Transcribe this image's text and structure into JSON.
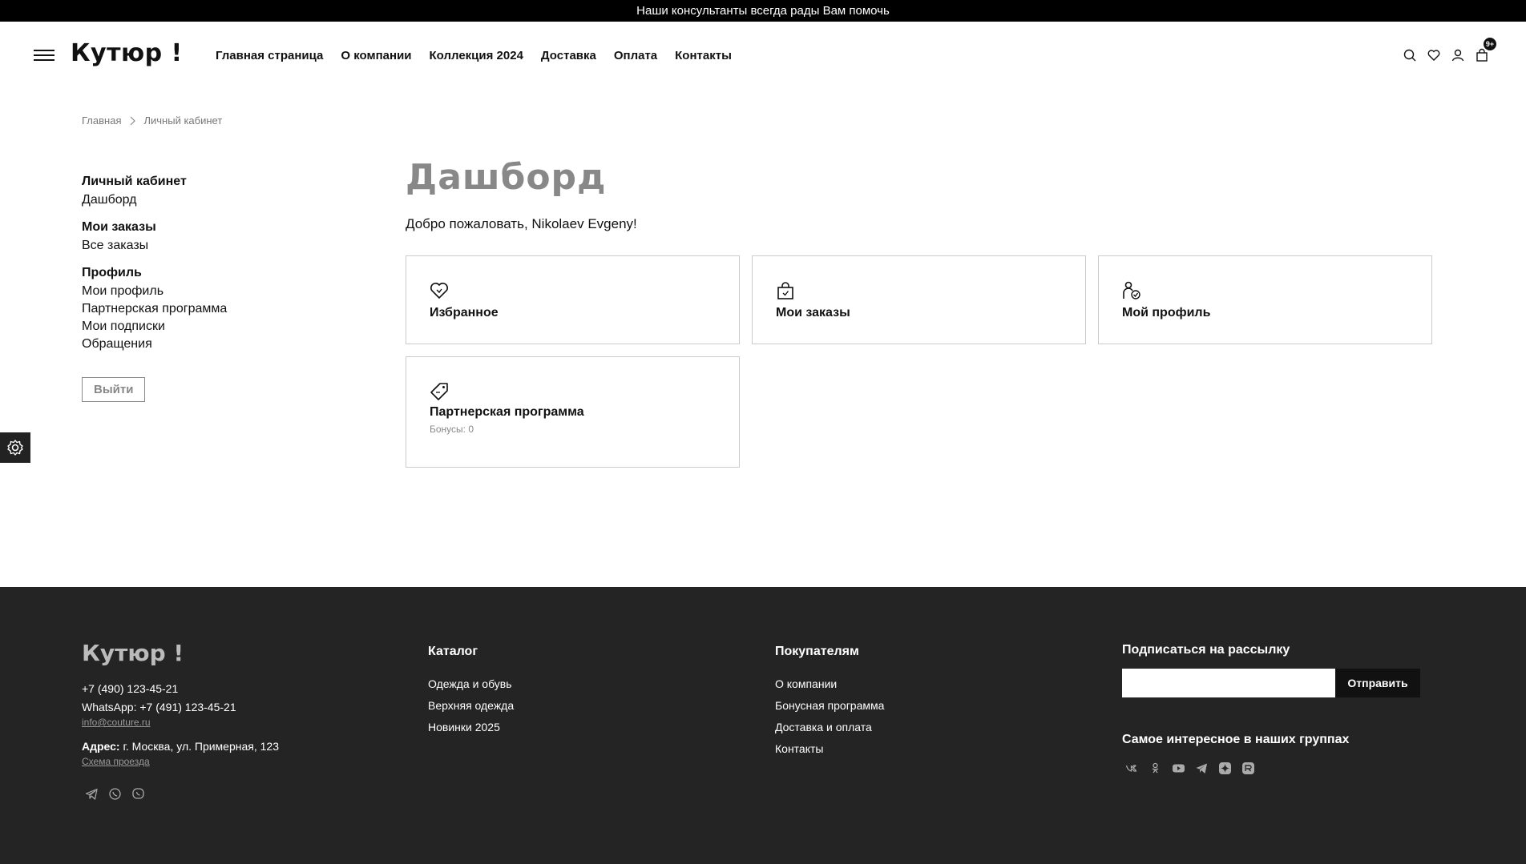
{
  "topbar": {
    "text": "Наши консультанты всегда рады Вам помочь"
  },
  "header": {
    "logo": "Кутюр !",
    "nav": [
      "Главная страница",
      "О компании",
      "Коллекция 2024",
      "Доставка",
      "Оплата",
      "Контакты"
    ],
    "cart_badge": "9+",
    "icons": [
      "search-icon",
      "heart-icon",
      "user-icon",
      "cart-icon"
    ]
  },
  "breadcrumb": {
    "home": "Главная",
    "current": "Личный кабинет"
  },
  "sidebar": {
    "groups": [
      {
        "title": "Личный кабинет",
        "links": [
          "Дашборд"
        ]
      },
      {
        "title": "Мои заказы",
        "links": [
          "Все заказы"
        ]
      },
      {
        "title": "Профиль",
        "links": [
          "Мои профиль",
          "Партнерская программа",
          "Мои подписки",
          "Обращения"
        ]
      }
    ],
    "logout": "Выйти"
  },
  "main": {
    "title": "Дашборд",
    "welcome": "Добро пожаловать, Nikolaev Evgeny!",
    "cards": [
      {
        "title": "Избранное",
        "icon": "heart-icon"
      },
      {
        "title": "Мои заказы",
        "icon": "shopping-bag-icon"
      },
      {
        "title": "Мой профиль",
        "icon": "user-check-icon"
      },
      {
        "title": "Партнерская программа",
        "subtitle": "Бонусы: 0",
        "icon": "price-tag-icon"
      }
    ]
  },
  "footer": {
    "logo": "Кутюр !",
    "phone": "+7 (490) 123-45-21",
    "whatsapp": "WhatsApp: +7 (491) 123-45-21",
    "email": "info@couture.ru",
    "address_label": "Адрес:",
    "address": " г. Москва, ул. Примерная, 123",
    "map_link": "Схема проезда",
    "catalog": {
      "title": "Каталог",
      "links": [
        "Одежда и обувь",
        "Верхняя одежда",
        "Новинки 2025"
      ]
    },
    "customers": {
      "title": "Покупателям",
      "links": [
        "О компании",
        "Бонусная программа",
        "Доставка и оплата",
        "Контакты"
      ]
    },
    "subscribe": {
      "title": "Подписаться на рассылку",
      "placeholder": "",
      "button": "Отправить"
    },
    "groups": {
      "title": "Самое интересное в наших группах"
    }
  }
}
